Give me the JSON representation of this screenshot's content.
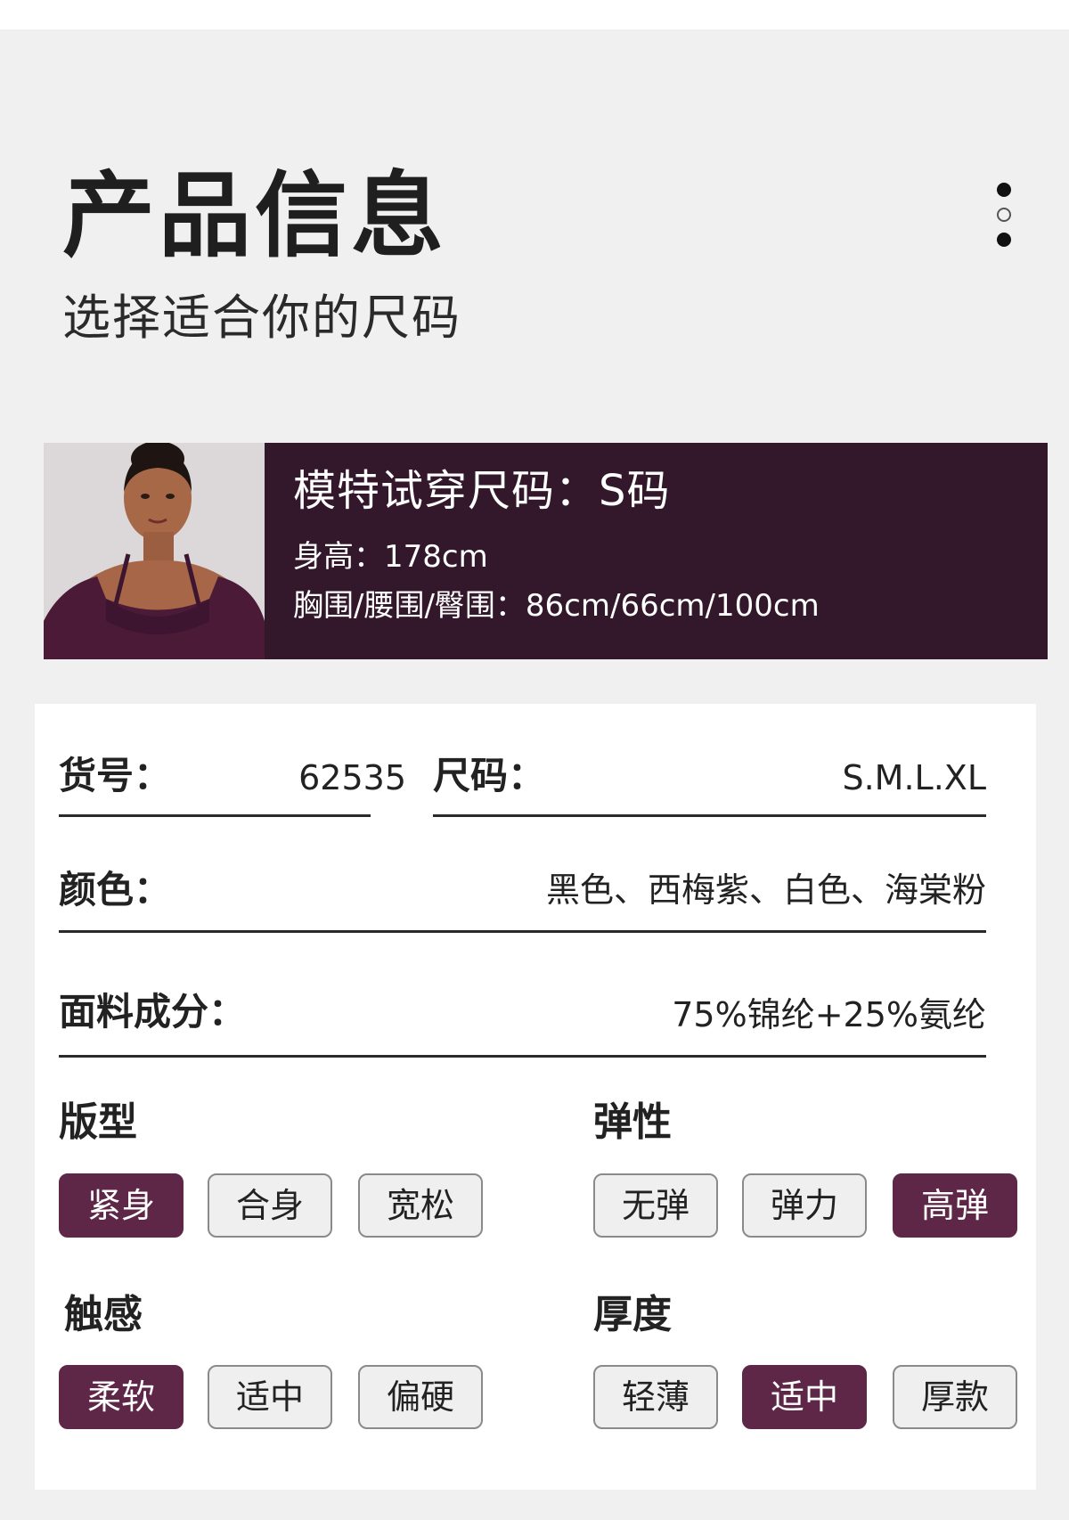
{
  "header": {
    "title": "产品信息",
    "subtitle": "选择适合你的尺码"
  },
  "pager": {
    "icon": "three-dot-pager",
    "active_index": 1
  },
  "model": {
    "photo_icon": "model-photo",
    "size_line": "模特试穿尺码：S码",
    "height_line": "身高：178cm",
    "measure_line": "胸围/腰围/臀围：86cm/66cm/100cm"
  },
  "specs": {
    "item_no_label": "货号：",
    "item_no_value": "62535",
    "size_label": "尺码：",
    "size_value": "S.M.L.XL",
    "color_label": "颜色：",
    "color_value": "黑色、西梅紫、白色、海棠粉",
    "fabric_label": "面料成分：",
    "fabric_value": "75%锦纶+25%氨纶"
  },
  "attributes": {
    "fit": {
      "title": "版型",
      "options": [
        "紧身",
        "合身",
        "宽松"
      ],
      "selected": "紧身"
    },
    "elasticity": {
      "title": "弹性",
      "options": [
        "无弹",
        "弹力",
        "高弹"
      ],
      "selected": "高弹"
    },
    "touch": {
      "title": "触感",
      "options": [
        "柔软",
        "适中",
        "偏硬"
      ],
      "selected": "柔软"
    },
    "thickness": {
      "title": "厚度",
      "options": [
        "轻薄",
        "适中",
        "厚款"
      ],
      "selected": "适中"
    }
  },
  "colors": {
    "accent": "#5f2747",
    "banner_bg": "#33172a",
    "page_bg": "#f0f0f0"
  }
}
